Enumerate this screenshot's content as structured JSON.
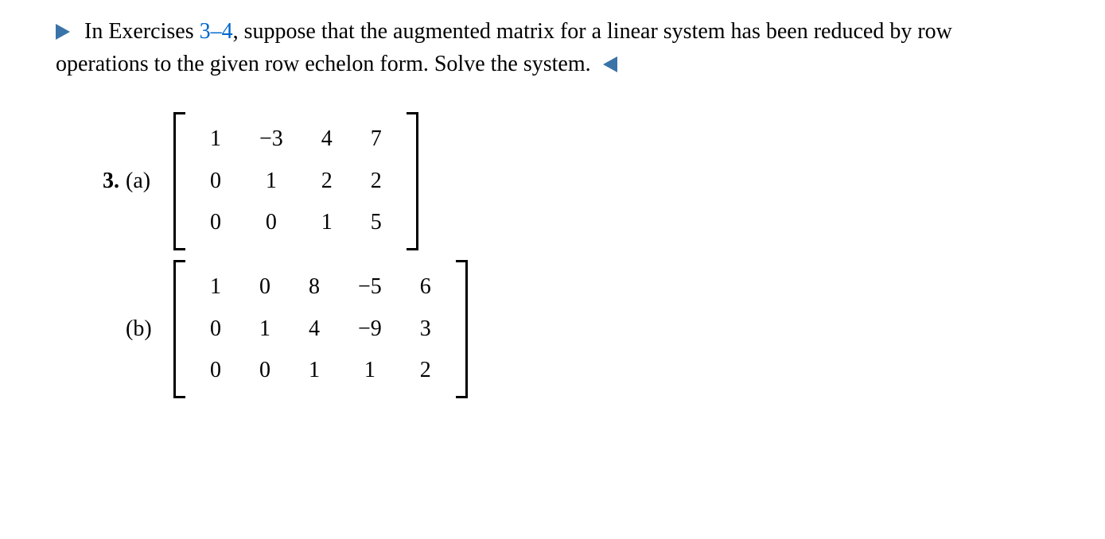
{
  "intro": {
    "prefix": "In Exercises ",
    "ref": "3–4",
    "rest": ", suppose that the augmented matrix for a linear system has been reduced by row operations to the given row echelon form. Solve the system."
  },
  "exercise": {
    "number": "3.",
    "parts": {
      "a": {
        "label": "(a)",
        "matrix": [
          [
            "1",
            "−3",
            "4",
            "7"
          ],
          [
            "0",
            "1",
            "2",
            "2"
          ],
          [
            "0",
            "0",
            "1",
            "5"
          ]
        ]
      },
      "b": {
        "label": "(b)",
        "matrix": [
          [
            "1",
            "0",
            "8",
            "−5",
            "6"
          ],
          [
            "0",
            "1",
            "4",
            "−9",
            "3"
          ],
          [
            "0",
            "0",
            "1",
            "1",
            "2"
          ]
        ]
      }
    }
  }
}
